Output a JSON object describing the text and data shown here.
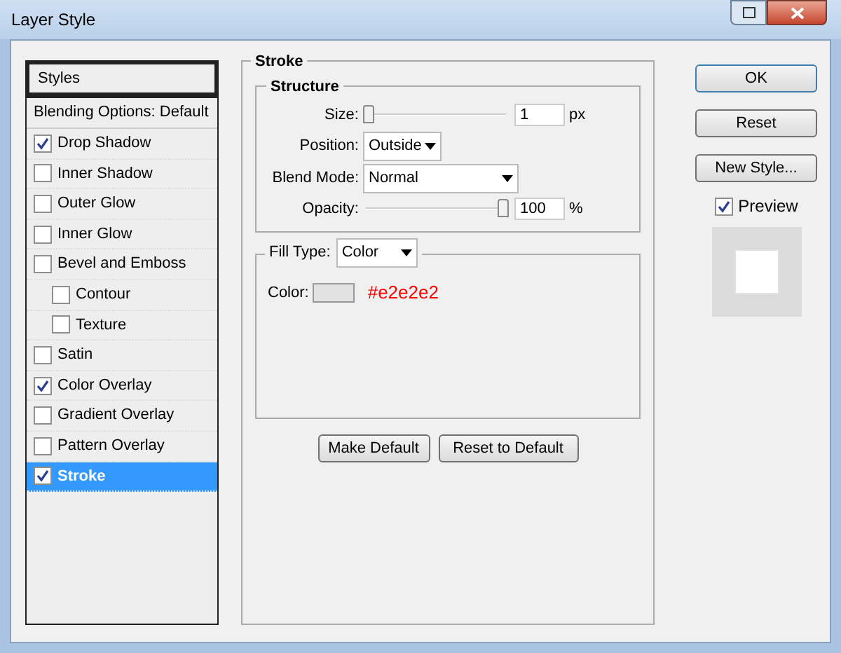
{
  "window": {
    "title": "Layer Style"
  },
  "styles": [
    {
      "label": "Styles",
      "kind": "header",
      "selected": false
    },
    {
      "label": "Blending Options: Default",
      "kind": "option",
      "selected": false
    },
    {
      "label": "Drop Shadow",
      "kind": "effect",
      "checked": true,
      "selected": false
    },
    {
      "label": "Inner Shadow",
      "kind": "effect",
      "checked": false,
      "selected": false
    },
    {
      "label": "Outer Glow",
      "kind": "effect",
      "checked": false,
      "selected": false
    },
    {
      "label": "Inner Glow",
      "kind": "effect",
      "checked": false,
      "selected": false
    },
    {
      "label": "Bevel and Emboss",
      "kind": "effect",
      "checked": false,
      "selected": false,
      "children": [
        {
          "label": "Contour",
          "kind": "effect",
          "checked": false,
          "selected": false
        },
        {
          "label": "Texture",
          "kind": "effect",
          "checked": false,
          "selected": false
        }
      ]
    },
    {
      "label": "Satin",
      "kind": "effect",
      "checked": false,
      "selected": false
    },
    {
      "label": "Color Overlay",
      "kind": "effect",
      "checked": true,
      "selected": false
    },
    {
      "label": "Gradient Overlay",
      "kind": "effect",
      "checked": false,
      "selected": false
    },
    {
      "label": "Pattern Overlay",
      "kind": "effect",
      "checked": false,
      "selected": false
    },
    {
      "label": "Stroke",
      "kind": "effect",
      "checked": true,
      "selected": true
    }
  ],
  "stroke": {
    "title": "Stroke",
    "structure": {
      "title": "Structure",
      "size": {
        "label": "Size:",
        "level": 0.0,
        "value": "1",
        "unit": "px"
      },
      "position": {
        "label": "Position:",
        "value": "Outside"
      },
      "blend_mode": {
        "label": "Blend Mode:",
        "value": "Normal"
      },
      "opacity": {
        "label": "Opacity:",
        "level": 1.0,
        "value": "100",
        "unit": "%"
      }
    },
    "fill_type": {
      "label": "Fill Type:",
      "value": "Color"
    },
    "color": {
      "label": "Color:",
      "color": "#e2e2e2",
      "note": "#e2e2e2"
    }
  },
  "actions": [
    "Make Default",
    "Reset to Default"
  ],
  "buttons": [
    "OK",
    "Reset",
    "New Style..."
  ],
  "preview": {
    "label": "Preview",
    "checked": true
  }
}
